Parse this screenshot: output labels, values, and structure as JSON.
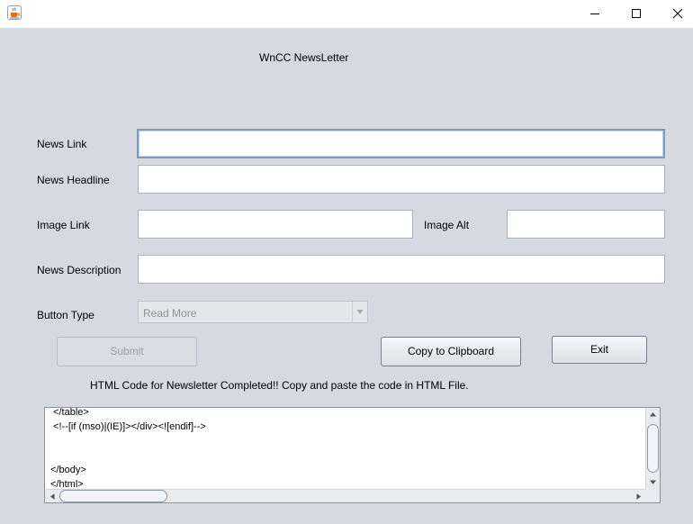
{
  "window": {
    "title": "",
    "icon": "java-cup-icon",
    "controls": [
      "minimize-icon",
      "maximize-icon",
      "close-icon"
    ]
  },
  "header": {
    "title": "WnCC NewsLetter"
  },
  "form": {
    "news_link": {
      "label": "News Link",
      "value": ""
    },
    "news_headline": {
      "label": "News Headline",
      "value": ""
    },
    "image_link": {
      "label": "Image Link",
      "value": ""
    },
    "image_alt": {
      "label": "Image Alt",
      "value": ""
    },
    "news_description": {
      "label": "News Description",
      "value": ""
    },
    "button_type": {
      "label": "Button Type",
      "selected": "Read More"
    }
  },
  "buttons": {
    "submit": "Submit",
    "copy": "Copy to Clipboard",
    "exit": "Exit"
  },
  "status": {
    "message": "HTML Code for Newsletter Completed!! Copy and paste the code in HTML File."
  },
  "output": {
    "code": " </table>\n <!--[if (mso)|(IE)]></div><![endif]-->\n\n\n</body>\n</html>"
  },
  "colors": {
    "background": "#d6d9df",
    "titlebar": "#ffffff",
    "field_border": "#a9b1bd",
    "focus_border": "#7f9db9",
    "disabled_text": "#9a9fa7"
  }
}
